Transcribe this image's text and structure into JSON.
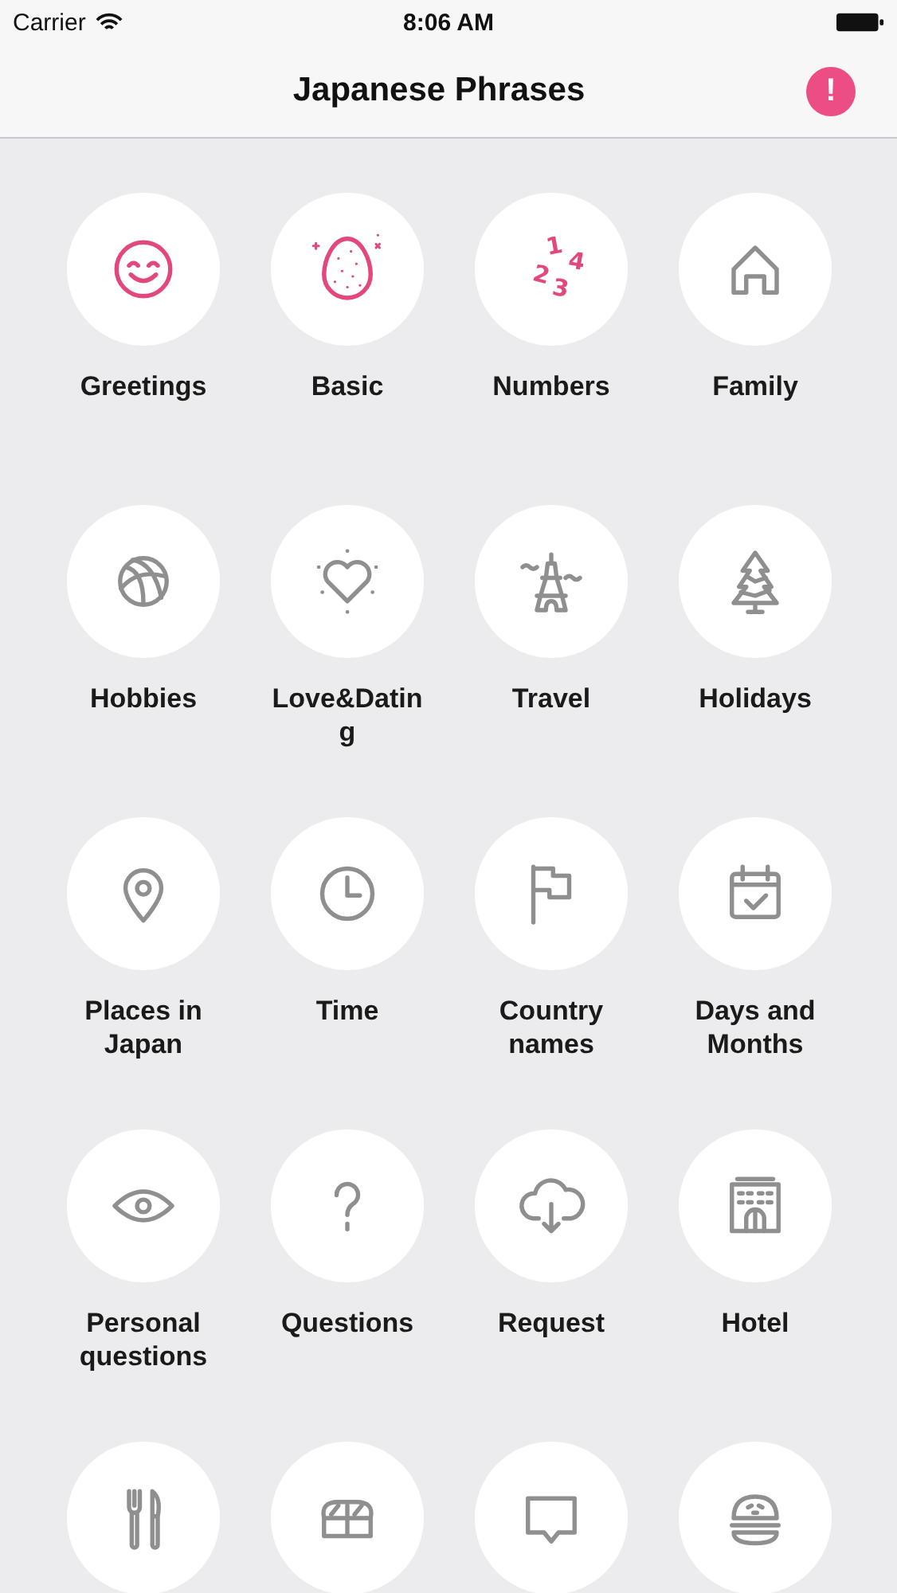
{
  "status_bar": {
    "carrier": "Carrier",
    "time": "8:06 AM"
  },
  "nav_bar": {
    "title": "Japanese Phrases",
    "info_button": {
      "glyph": "!"
    }
  },
  "categories": [
    {
      "label": "Greetings",
      "kind": "smile",
      "color": "#e2487d"
    },
    {
      "label": "Basic",
      "kind": "egg",
      "color": "#e2487d"
    },
    {
      "label": "Numbers",
      "kind": "digits",
      "color": "#e2487d",
      "glyphs": [
        "1",
        "2",
        "3",
        "4"
      ]
    },
    {
      "label": "Family",
      "kind": "house",
      "color": "#8f8f8f"
    },
    {
      "label": "Hobbies",
      "kind": "ball",
      "color": "#8f8f8f"
    },
    {
      "label": "Love&Dating",
      "kind": "heart",
      "color": "#8f8f8f"
    },
    {
      "label": "Travel",
      "kind": "tower",
      "color": "#8f8f8f"
    },
    {
      "label": "Holidays",
      "kind": "tree",
      "color": "#8f8f8f"
    },
    {
      "label": "Places in Japan",
      "kind": "pin",
      "color": "#8f8f8f"
    },
    {
      "label": "Time",
      "kind": "clock",
      "color": "#8f8f8f"
    },
    {
      "label": "Country names",
      "kind": "flag",
      "color": "#8f8f8f"
    },
    {
      "label": "Days and Months",
      "kind": "calendar",
      "color": "#8f8f8f"
    },
    {
      "label": "Personal questions",
      "kind": "eye",
      "color": "#8f8f8f"
    },
    {
      "label": "Questions",
      "kind": "question",
      "color": "#8f8f8f"
    },
    {
      "label": "Request",
      "kind": "cloud",
      "color": "#8f8f8f"
    },
    {
      "label": "Hotel",
      "kind": "building",
      "color": "#8f8f8f"
    },
    {
      "kind": "cutlery",
      "color": "#8f8f8f"
    },
    {
      "kind": "sushi",
      "color": "#8f8f8f"
    },
    {
      "kind": "speech",
      "color": "#8f8f8f"
    },
    {
      "kind": "burger",
      "color": "#8f8f8f"
    }
  ]
}
